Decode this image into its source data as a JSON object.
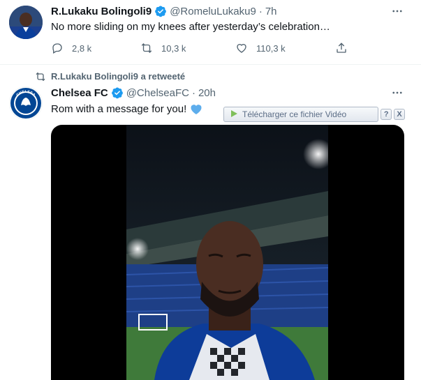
{
  "tweet1": {
    "display_name": "R.Lukaku Bolingoli9",
    "handle": "@RomeluLukaku9",
    "time": "7h",
    "text": "No more sliding on my knees after yesterday’s celebration…",
    "actions": {
      "replies": "2,8 k",
      "retweets": "10,3 k",
      "likes": "110,3 k"
    }
  },
  "retweet_label": "R.Lukaku Bolingoli9 a retweeté",
  "tweet2": {
    "display_name": "Chelsea FC",
    "handle": "@ChelseaFC",
    "time": "20h",
    "text": "Rom with a message for you!",
    "emoji": "💙",
    "avatar_text": "CHELSEA"
  },
  "download_bar": {
    "label": "Télécharger ce fichier Vidéo",
    "help": "?",
    "close": "X"
  },
  "icons": {
    "verified": "verified-badge-icon",
    "more": "more-horizontal-icon",
    "reply": "reply-icon",
    "retweet": "retweet-icon",
    "like": "heart-icon",
    "share": "share-icon"
  },
  "colors": {
    "verified": "#1d9bf0",
    "secondary_text": "#536471",
    "chelsea_blue": "#034694"
  }
}
